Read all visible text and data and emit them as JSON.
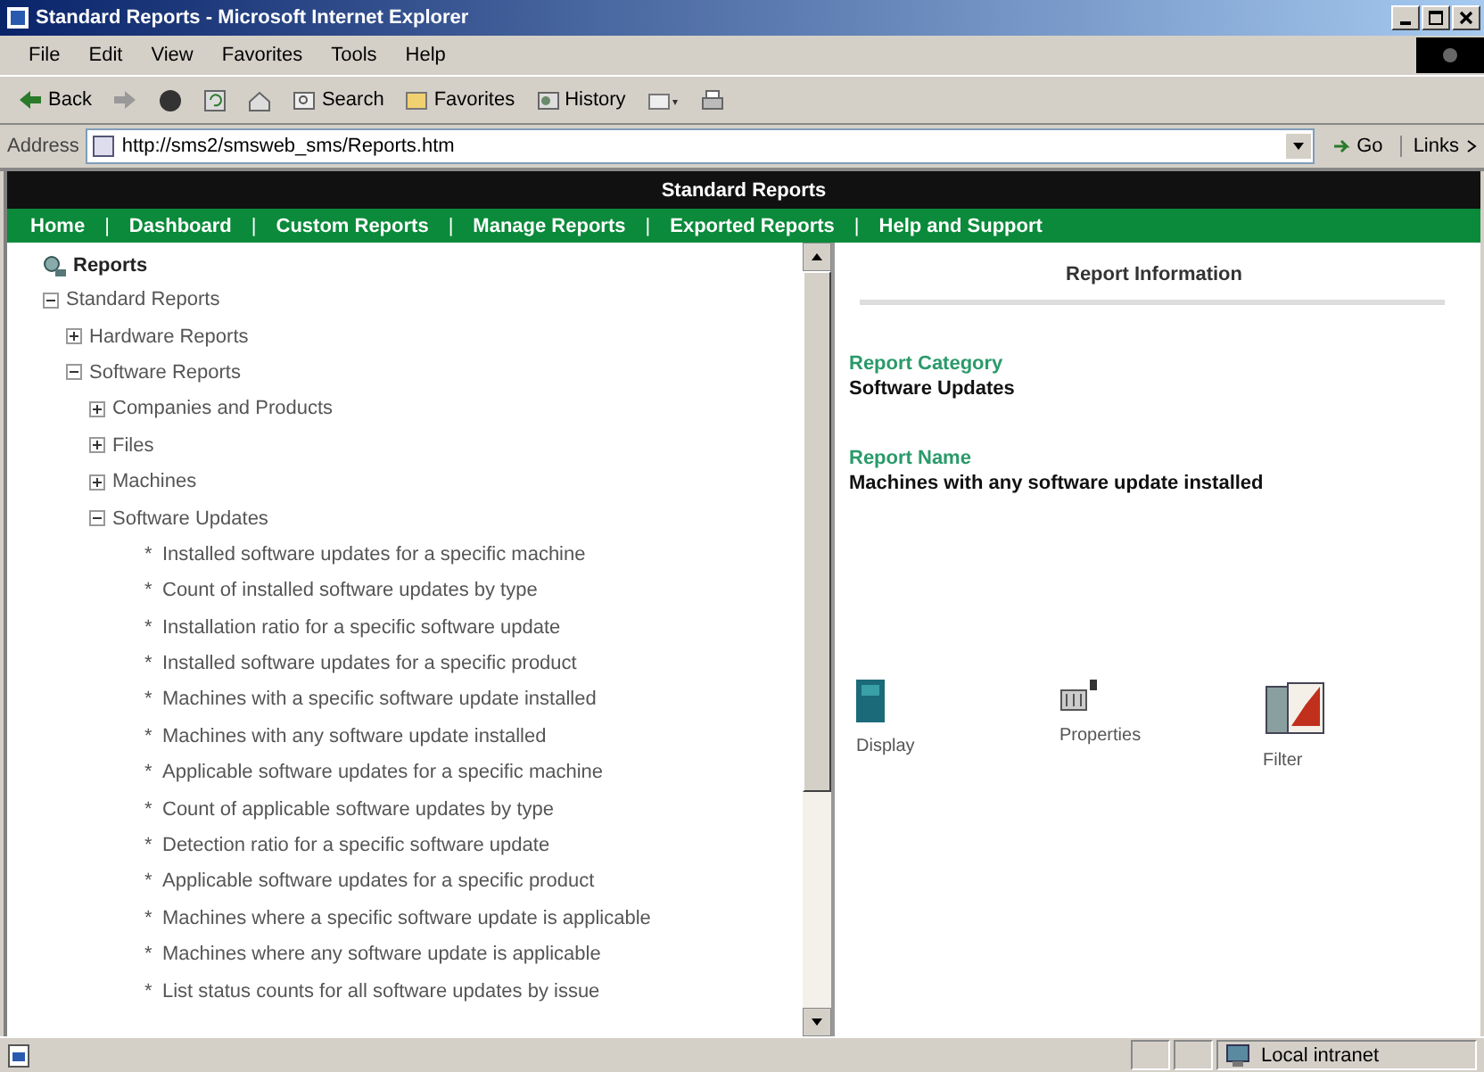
{
  "window": {
    "title": "Standard Reports - Microsoft Internet Explorer"
  },
  "menu": [
    "File",
    "Edit",
    "View",
    "Favorites",
    "Tools",
    "Help"
  ],
  "toolbar": [
    {
      "kind": "back",
      "label": "Back"
    },
    {
      "kind": "forward"
    },
    {
      "kind": "stop"
    },
    {
      "kind": "refresh"
    },
    {
      "kind": "home"
    },
    {
      "kind": "search",
      "label": "Search"
    },
    {
      "kind": "favorites",
      "label": "Favorites"
    },
    {
      "kind": "history",
      "label": "History"
    },
    {
      "kind": "mail"
    },
    {
      "kind": "print"
    }
  ],
  "address": {
    "label": "Address",
    "value": "http://sms2/smsweb_sms/Reports.htm",
    "go": "Go",
    "links": "Links"
  },
  "page": {
    "title": "Standard Reports",
    "nav": [
      "Home",
      "Dashboard",
      "Custom Reports",
      "Manage Reports",
      "Exported Reports",
      "Help and Support"
    ],
    "separator": "|"
  },
  "tree": {
    "label": "Reports",
    "children": [
      {
        "label": "Standard Reports",
        "expanded": true,
        "children": [
          {
            "label": "Hardware Reports",
            "expanded": false
          },
          {
            "label": "Software Reports",
            "expanded": true,
            "children": [
              {
                "label": "Companies and Products",
                "expanded": false
              },
              {
                "label": "Files",
                "expanded": false
              },
              {
                "label": "Machines",
                "expanded": false
              },
              {
                "label": "Software Updates",
                "expanded": true,
                "children": [
                  {
                    "kind": "report",
                    "bullet": "*",
                    "label": "Installed software updates for a specific machine"
                  },
                  {
                    "kind": "report",
                    "bullet": "*",
                    "label": "Count of installed software updates by type"
                  },
                  {
                    "kind": "report",
                    "bullet": "*",
                    "label": "Installation ratio for a specific software update"
                  },
                  {
                    "kind": "report",
                    "bullet": "*",
                    "label": "Installed software updates for a specific product"
                  },
                  {
                    "kind": "report",
                    "bullet": "*",
                    "label": "Machines with a specific software update installed"
                  },
                  {
                    "kind": "report",
                    "bullet": "*",
                    "label": "Machines with any software update installed"
                  },
                  {
                    "kind": "report",
                    "bullet": "*",
                    "label": "Applicable software updates for a specific machine"
                  },
                  {
                    "kind": "report",
                    "bullet": "*",
                    "label": "Count of applicable software updates by type"
                  },
                  {
                    "kind": "report",
                    "bullet": "*",
                    "label": "Detection ratio for a specific software update"
                  },
                  {
                    "kind": "report",
                    "bullet": "*",
                    "label": "Applicable software updates for a specific product"
                  },
                  {
                    "kind": "report",
                    "bullet": "*",
                    "label": "Machines where a specific software update is applicable"
                  },
                  {
                    "kind": "report",
                    "bullet": "*",
                    "label": "Machines where any software update is applicable"
                  },
                  {
                    "kind": "report",
                    "bullet": "*",
                    "label": "List status counts for all software updates by issue"
                  }
                ]
              }
            ]
          }
        ]
      }
    ]
  },
  "info": {
    "title": "Report Information",
    "fields": [
      {
        "label": "Report Category",
        "value": "Software Updates"
      },
      {
        "label": "Report Name",
        "value": "Machines with any software update installed"
      }
    ],
    "actions": [
      {
        "kind": "display",
        "label": "Display"
      },
      {
        "kind": "properties",
        "label": "Properties"
      },
      {
        "kind": "filter",
        "label": "Filter"
      }
    ]
  },
  "status_bar": {
    "zone": "Local intranet"
  }
}
